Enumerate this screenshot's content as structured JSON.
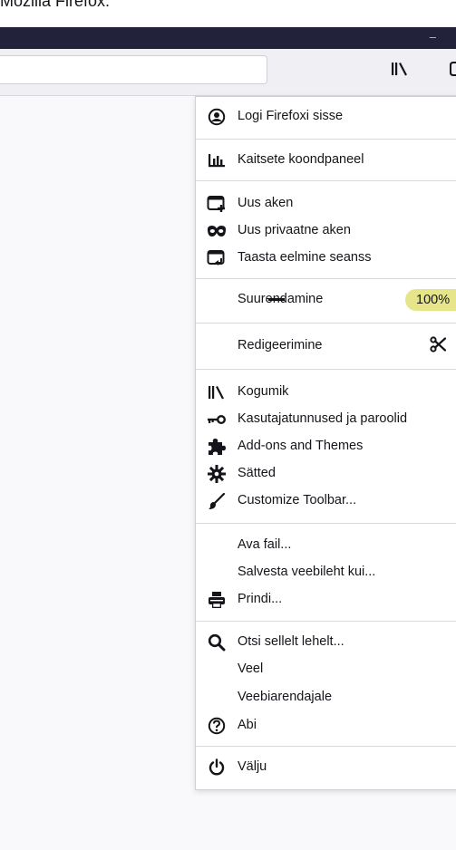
{
  "caption": "Mozilla Firefox:",
  "window": {
    "minimize_label": "–"
  },
  "menu": {
    "items": [
      {
        "id": "sign-in",
        "label": "Logi Firefoxi sisse",
        "icon": "account-icon"
      },
      {
        "id": "protections",
        "label": "Kaitsete koondpaneel",
        "icon": "dashboard-icon"
      },
      {
        "id": "new-window",
        "label": "Uus aken",
        "icon": "new-window-icon"
      },
      {
        "id": "private-window",
        "label": "Uus privaatne aken",
        "icon": "private-mask-icon"
      },
      {
        "id": "restore-session",
        "label": "Taasta eelmine seanss",
        "icon": "restore-session-icon"
      },
      {
        "id": "zoom",
        "label": "Suurendamine",
        "icon": ""
      },
      {
        "id": "edit",
        "label": "Redigeerimine",
        "icon": ""
      },
      {
        "id": "library",
        "label": "Kogumik",
        "icon": "library-icon"
      },
      {
        "id": "passwords",
        "label": "Kasutajatunnused ja paroolid",
        "icon": "key-icon"
      },
      {
        "id": "addons",
        "label": "Add-ons and Themes",
        "icon": "puzzle-icon"
      },
      {
        "id": "settings",
        "label": "Sätted",
        "icon": "gear-icon"
      },
      {
        "id": "customize",
        "label": "Customize Toolbar...",
        "icon": "brush-icon"
      },
      {
        "id": "open-file",
        "label": "Ava fail...",
        "icon": ""
      },
      {
        "id": "save-page",
        "label": "Salvesta veebileht kui...",
        "icon": ""
      },
      {
        "id": "print",
        "label": "Prindi...",
        "icon": "printer-icon"
      },
      {
        "id": "find",
        "label": "Otsi sellelt lehelt...",
        "icon": "search-icon"
      },
      {
        "id": "more",
        "label": "Veel",
        "icon": ""
      },
      {
        "id": "devtools",
        "label": "Veebiarendajale",
        "icon": ""
      },
      {
        "id": "help",
        "label": "Abi",
        "icon": "help-icon"
      },
      {
        "id": "quit",
        "label": "Välju",
        "icon": "power-icon"
      }
    ],
    "zoom_value": "100%",
    "highlight_color": "#fff44a"
  }
}
